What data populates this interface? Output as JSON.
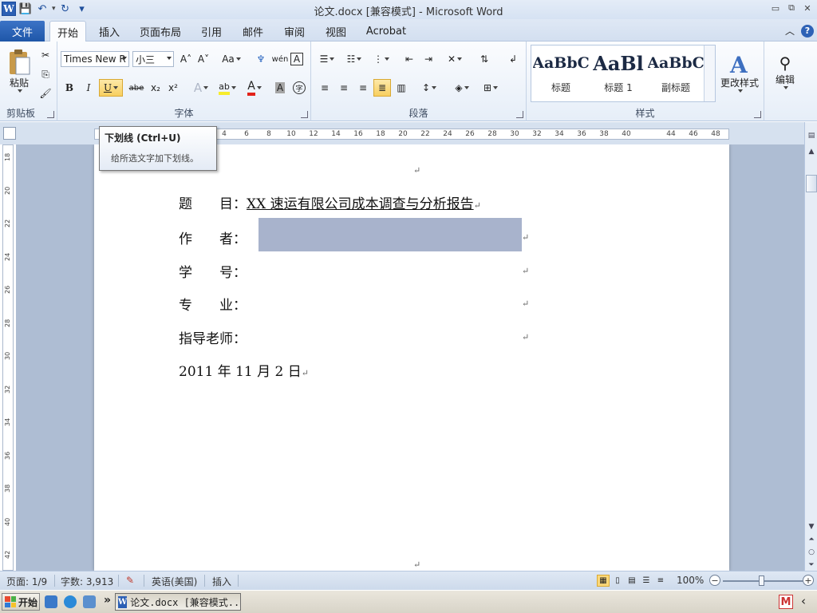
{
  "titlebar": {
    "title": "论文.docx [兼容模式] - Microsoft Word",
    "word_logo": "W",
    "qat": {
      "save_icon": "💾",
      "undo_icon": "↶",
      "redo_icon": "↻",
      "customize_icon": "▾"
    },
    "min_icon": "▭",
    "restore_icon": "⧉",
    "close_icon": "✕"
  },
  "tabs": {
    "file": "文件",
    "items": [
      "开始",
      "插入",
      "页面布局",
      "引用",
      "邮件",
      "审阅",
      "视图",
      "Acrobat"
    ],
    "active": "开始",
    "minimize_icon": "︿",
    "help": "?"
  },
  "ribbon": {
    "clipboard": {
      "label": "剪贴板",
      "paste": "粘贴"
    },
    "font": {
      "label": "字体",
      "font_name": "Times New R",
      "font_size": "小三",
      "grow": "A˄",
      "shrink": "A˅",
      "change_case": "Aa",
      "clear_format": "♆",
      "phonetic": "wén",
      "border_char": "A",
      "bold": "B",
      "italic": "I",
      "underline": "U",
      "strike": "abe",
      "subscript": "x₂",
      "superscript": "x²",
      "effects": "A",
      "highlight": "ab",
      "font_color": "A",
      "char_shading": "A",
      "enclose": "字"
    },
    "paragraph": {
      "label": "段落"
    },
    "styles": {
      "label": "样式",
      "items": [
        {
          "preview": "AaBbC",
          "name": "标题"
        },
        {
          "preview": "AaBl",
          "name": "标题 1"
        },
        {
          "preview": "AaBbC",
          "name": "副标题"
        }
      ],
      "change_styles": "更改样式"
    },
    "editing": {
      "label": "编辑"
    }
  },
  "tooltip": {
    "title": "下划线 (Ctrl+U)",
    "body": "给所选文字加下划线。"
  },
  "hruler_ticks": [
    "4",
    "6",
    "8",
    "10",
    "12",
    "14",
    "16",
    "18",
    "20",
    "22",
    "24",
    "26",
    "28",
    "30",
    "32",
    "34",
    "36",
    "38",
    "40",
    "",
    "44",
    "46",
    "48"
  ],
  "vruler_ticks": [
    "18",
    "20",
    "22",
    "24",
    "26",
    "28",
    "30",
    "32",
    "34",
    "36",
    "38",
    "40",
    "42"
  ],
  "document": {
    "title_label": "题　　目：",
    "title_value": "XX 速运有限公司成本调查与分析报告",
    "author_label": "作　　者：",
    "student_id_label": "学　　号：",
    "major_label": "专　　业：",
    "advisor_label": "指导老师：",
    "date": "2011 年 11 月 2 日",
    "para_mark": "↵"
  },
  "statusbar": {
    "page": "页面: 1/9",
    "words": "字数: 3,913",
    "language": "英语(美国)",
    "mode": "插入",
    "zoom": "100%",
    "zoom_minus": "−",
    "zoom_plus": "+"
  },
  "taskbar": {
    "start": "开始",
    "more": "»",
    "task": "论文.docx [兼容模式...",
    "task_icon": "W",
    "tray_icon": "M",
    "tray_arrow": "‹"
  },
  "colors": {
    "selection": "#a8b3cc",
    "file_tab": "#2b5fb4",
    "doc_background": "#aebdd3"
  }
}
